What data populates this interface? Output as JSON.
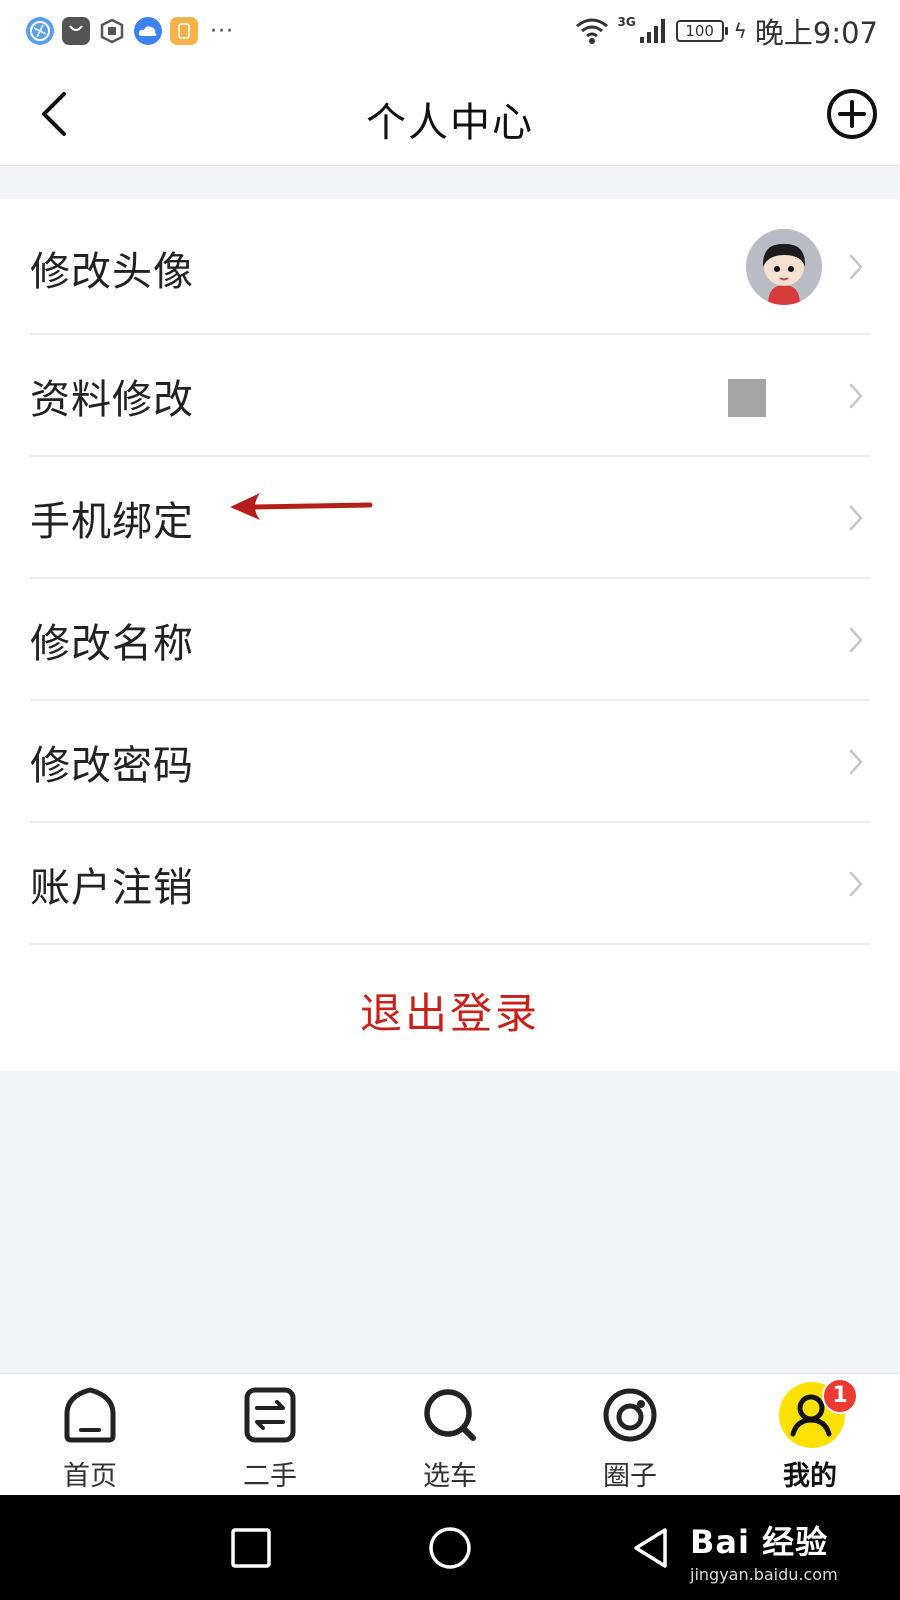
{
  "status_bar": {
    "network": "3G",
    "battery": "100",
    "time": "晚上9:07",
    "app_icons": [
      "browser-icon",
      "huawei-store-icon",
      "hexagon-app-icon",
      "weather-icon",
      "wallet-icon"
    ],
    "more": "···"
  },
  "header": {
    "title": "个人中心",
    "back_icon": "chevron-left-icon",
    "add_icon": "plus-circle-icon"
  },
  "menu": {
    "items": [
      {
        "label": "修改头像",
        "trailing": "avatar"
      },
      {
        "label": "资料修改",
        "trailing": "thumbnail"
      },
      {
        "label": "手机绑定",
        "annotation": "red-arrow"
      },
      {
        "label": "修改名称"
      },
      {
        "label": "修改密码"
      },
      {
        "label": "账户注销"
      }
    ],
    "logout_label": "退出登录"
  },
  "tabbar": {
    "tabs": [
      {
        "label": "首页",
        "icon": "home-icon",
        "active": false
      },
      {
        "label": "二手",
        "icon": "exchange-icon",
        "active": false
      },
      {
        "label": "选车",
        "icon": "search-icon",
        "active": false
      },
      {
        "label": "圈子",
        "icon": "circle-icon",
        "active": false
      },
      {
        "label": "我的",
        "icon": "profile-icon",
        "active": true,
        "badge": "1"
      }
    ]
  },
  "system_nav": {
    "buttons": [
      "recent-apps-icon",
      "home-circle-icon",
      "back-triangle-icon"
    ]
  },
  "watermark": {
    "logo": "Bai 经验",
    "url": "jingyan.baidu.com"
  },
  "colors": {
    "accent_red": "#c8211a",
    "badge_red": "#ee3a33",
    "me_yellow": "#ffe100",
    "page_bg": "#f4f5f9"
  }
}
